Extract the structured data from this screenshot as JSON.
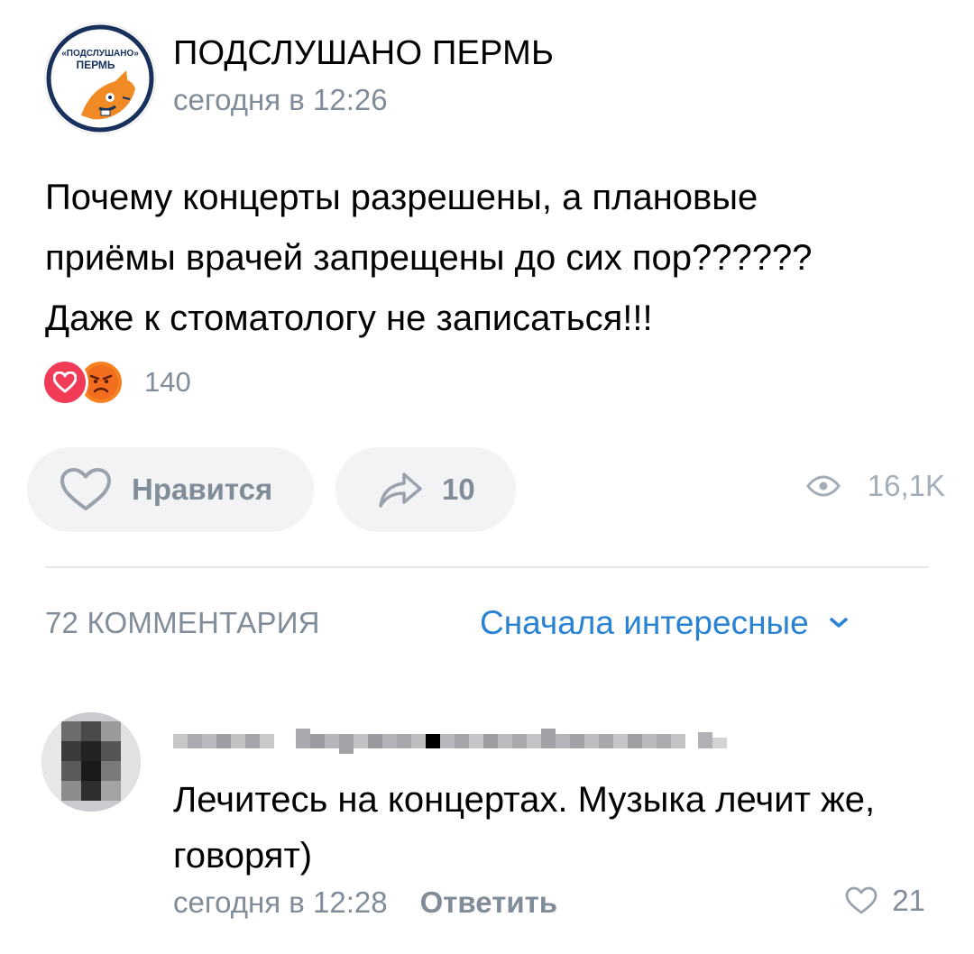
{
  "post": {
    "group": {
      "name": "ПОДСЛУШАНО ПЕРМЬ",
      "avatar_text_top": "«ПОДСЛУШАНО»",
      "avatar_text_bottom": "ПЕРМЬ"
    },
    "time": "сегодня в 12:26",
    "text": "Почему концерты разрешены, а плановые\nприёмы врачей запрещены до сих пор??????\nДаже к стоматологу не записаться!!!",
    "reactions": {
      "icons": [
        "heart-icon",
        "angry-face-icon"
      ],
      "count": "140"
    },
    "actions": {
      "like_label": "Нравится",
      "share_count": "10",
      "views_count": "16,1K"
    }
  },
  "comments": {
    "count_label": "72 КОММЕНТАРИЯ",
    "sort_label": "Сначала интересные",
    "items": [
      {
        "author": "Алена Сергеевна-Петрова",
        "author_blurred": true,
        "text": "Лечитесь на концертах. Музыка лечит же, говорят)",
        "time": "сегодня в 12:28",
        "reply_label": "Ответить",
        "likes": "21"
      }
    ]
  },
  "colors": {
    "secondary_text": "#818c99",
    "accent_blue": "#2a82d2",
    "pill_bg": "#f2f3f5",
    "heart_red": "#f23c57",
    "angry_orange": "#f6821f"
  }
}
